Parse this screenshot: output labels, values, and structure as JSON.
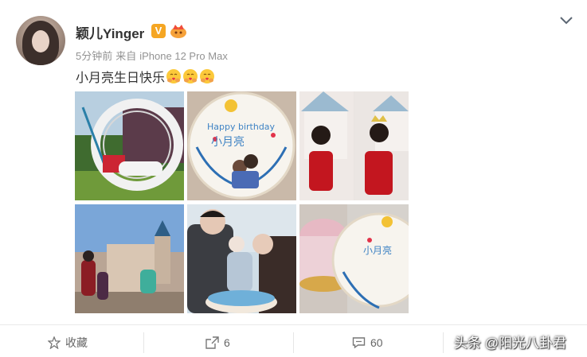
{
  "post": {
    "username": "颖儿Yinger",
    "verified_badge": "V",
    "time": "5分钟前",
    "source_prefix": "来自",
    "device": "iPhone 12 Pro Max",
    "text": "小月亮生日快乐",
    "emoji_count": 3,
    "emoji_icon": "hug-emoji-icon"
  },
  "images": [
    {
      "name": "swing-ring-photo"
    },
    {
      "name": "birthday-cake-top-photo"
    },
    {
      "name": "dollhouse-girl-photo"
    },
    {
      "name": "castle-park-photo"
    },
    {
      "name": "family-cake-photo"
    },
    {
      "name": "cake-closeup-photo"
    }
  ],
  "actions": {
    "favorite_label": "收藏",
    "repost_count": "6",
    "comment_count": "60"
  },
  "watermark": "头条 @阳光八卦君",
  "colors": {
    "accent": "#f5a623",
    "text_primary": "#333333",
    "text_meta": "#939393"
  }
}
